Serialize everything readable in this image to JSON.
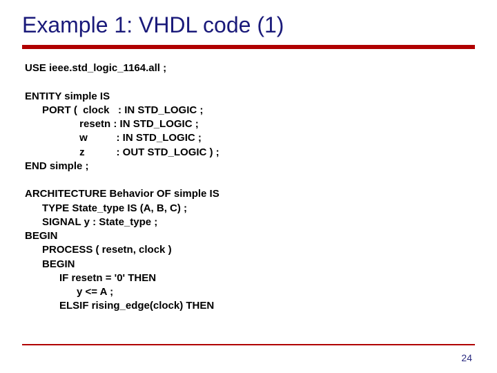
{
  "title": "Example 1: VHDL code (1)",
  "code": {
    "l1": "USE ieee.std_logic_1164.all ;",
    "l2": "",
    "l3": "ENTITY simple IS",
    "l4": "      PORT (  clock   : IN STD_LOGIC ;",
    "l5": "                   resetn : IN STD_LOGIC ;",
    "l6": "                   w          : IN STD_LOGIC ;",
    "l7": "                   z           : OUT STD_LOGIC ) ;",
    "l8": "END simple ;",
    "l9": "",
    "l10": "ARCHITECTURE Behavior OF simple IS",
    "l11": "      TYPE State_type IS (A, B, C) ;",
    "l12": "      SIGNAL y : State_type ;",
    "l13": "BEGIN",
    "l14": "      PROCESS ( resetn, clock )",
    "l15": "      BEGIN",
    "l16": "            IF resetn = '0' THEN",
    "l17": "                  y <= A ;",
    "l18": "            ELSIF rising_edge(clock) THEN"
  },
  "page_number": "24"
}
